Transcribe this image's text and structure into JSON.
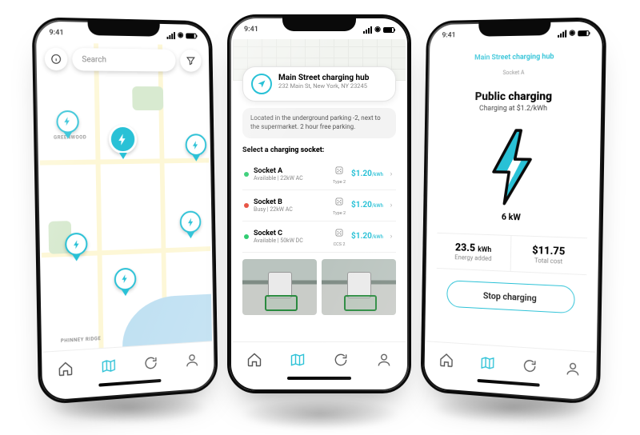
{
  "status_time": "9:41",
  "colors": {
    "teal": "#29c1d6"
  },
  "screen1": {
    "search_placeholder": "Search",
    "map_labels": {
      "greenwood": "GREENWOOD",
      "phinney": "PHINNEY RIDGE"
    }
  },
  "screen2": {
    "hub_name": "Main Street charging hub",
    "hub_address": "232 Main St, New York, NY 23245",
    "description": "Located in the underground parking -2, next to the supermarket. 2 hour free parking.",
    "select_label": "Select a charging socket:",
    "sockets": [
      {
        "name": "Socket A",
        "status": "Available",
        "power": "22kW AC",
        "plug": "Type 2",
        "price": "$1.20",
        "unit": "/kWh",
        "dot": "#2ecc71"
      },
      {
        "name": "Socket B",
        "status": "Busy",
        "power": "22kW AC",
        "plug": "Type 2",
        "price": "$1.20",
        "unit": "/kWh",
        "dot": "#e74c3c"
      },
      {
        "name": "Socket C",
        "status": "Available",
        "power": "50kW DC",
        "plug": "CCS 2",
        "price": "$1.20",
        "unit": "/kWh",
        "dot": "#2ecc71"
      }
    ]
  },
  "screen3": {
    "hub_link": "Main Street charging hub",
    "socket_label": "Socket A",
    "title": "Public charging",
    "rate_text": "Charging at $1.2/kWh",
    "power_now": "6 kW",
    "energy_added": {
      "value": "23.5",
      "unit": "kWh",
      "label": "Energy added"
    },
    "total_cost": {
      "value": "$11.75",
      "label": "Total cost"
    },
    "stop_label": "Stop charging"
  },
  "nav_icons": [
    "home",
    "map",
    "refresh",
    "profile"
  ]
}
